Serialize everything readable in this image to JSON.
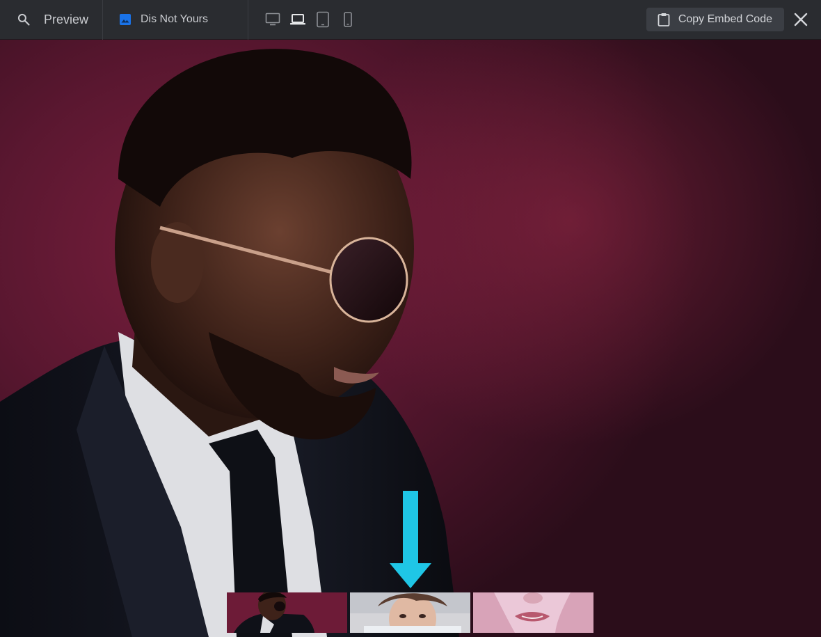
{
  "topbar": {
    "preview_label": "Preview",
    "document_title": "Dis Not Yours",
    "embed_label": "Copy Embed Code",
    "icons": {
      "search": "search-icon",
      "image": "image-icon",
      "desktop": "desktop-icon",
      "laptop": "laptop-icon",
      "tablet": "tablet-icon",
      "phone": "phone-icon",
      "clipboard": "clipboard-icon",
      "close": "close-icon"
    },
    "active_device": "laptop"
  },
  "colors": {
    "topbar_bg": "#2a2c30",
    "accent_blue": "#1a73e8",
    "arrow_cyan": "#1fc6e6",
    "backdrop_red": "#7a1f3d"
  },
  "thumbnails": [
    {
      "name": "thumb-man-sunglasses"
    },
    {
      "name": "thumb-woman-peeking"
    },
    {
      "name": "thumb-lips-pink"
    }
  ]
}
